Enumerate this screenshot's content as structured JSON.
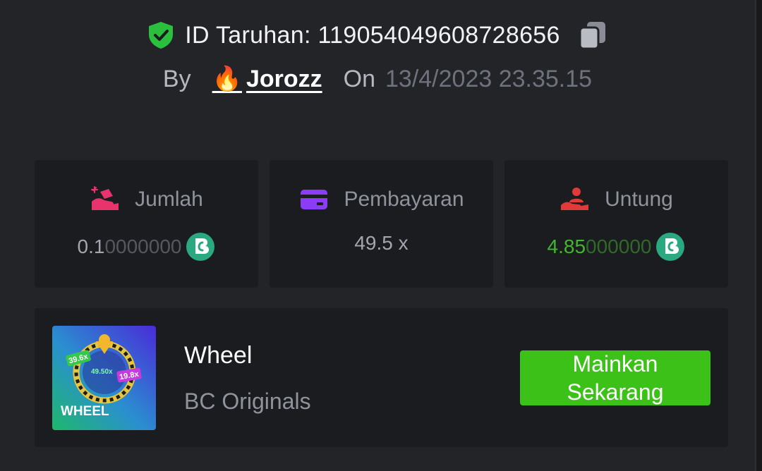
{
  "bet": {
    "id_label": "ID Taruhan:",
    "id_value": "119054049608728656",
    "by_label": "By",
    "username": "Jorozz",
    "user_badge_emoji": "🔥",
    "on_label": "On",
    "datetime": "13/4/2023 23.35.15"
  },
  "stats": {
    "amount": {
      "label": "Jumlah",
      "value_main": "0.1",
      "value_dim": "0000000",
      "icon": "hand-coins-icon",
      "icon_color": "#e8336d"
    },
    "payout": {
      "label": "Pembayaran",
      "value": "49.5 x",
      "icon": "credit-card-icon",
      "icon_color": "#8b3df5"
    },
    "profit": {
      "label": "Untung",
      "value_main": "4.85",
      "value_dim": "000000",
      "icon": "hand-person-icon",
      "icon_color": "#e03a3a"
    },
    "coin_icon": "bc-coin-icon",
    "coin_color": "#2aa980"
  },
  "game": {
    "name": "Wheel",
    "provider": "BC Originals",
    "thumb_title": "WHEEL",
    "thumb_labels": [
      "39.6x",
      "49.50x",
      "19.8x"
    ],
    "play_line1": "Mainkan",
    "play_line2": "Sekarang",
    "play_color": "#3bc117"
  }
}
